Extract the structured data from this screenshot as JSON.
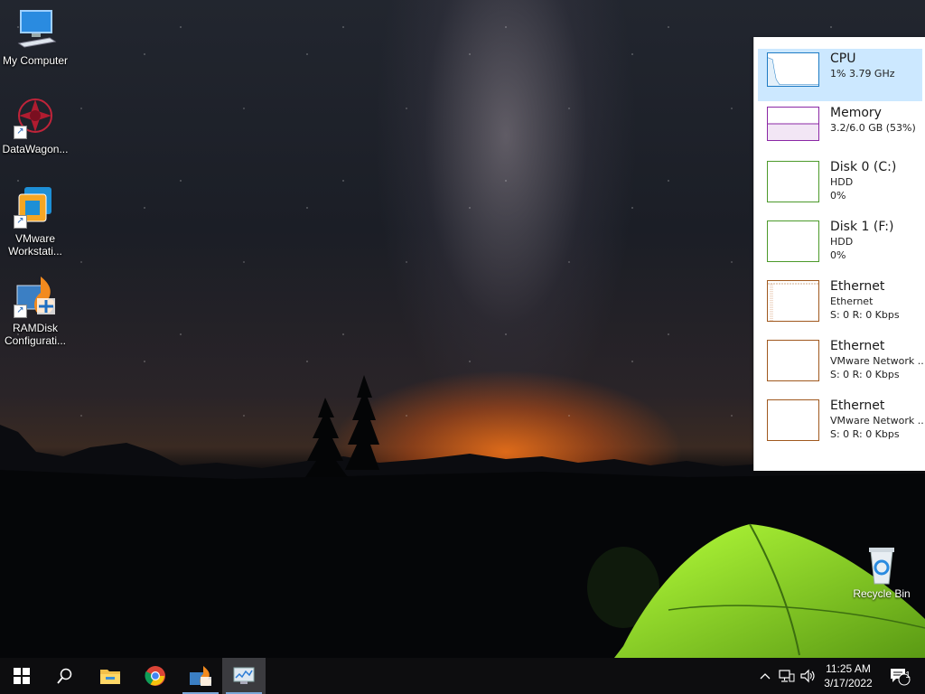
{
  "desktop": {
    "icons": [
      {
        "label": "My Computer",
        "icon": "computer-icon"
      },
      {
        "label": "DataWagon...",
        "icon": "datawagon-icon"
      },
      {
        "label": "VMware\nWorkstati...",
        "icon": "vmware-icon"
      },
      {
        "label": "RAMDisk\nConfigurati...",
        "icon": "ramdisk-icon"
      }
    ],
    "recycle_bin": {
      "label": "Recycle Bin",
      "icon": "recycle-bin-icon"
    }
  },
  "performance": {
    "items": [
      {
        "title": "CPU",
        "line1": "1% 3.79 GHz",
        "line2": "",
        "color": "#1e7bc4",
        "selected": true
      },
      {
        "title": "Memory",
        "line1": "3.2/6.0 GB (53%)",
        "line2": "",
        "color": "#8b27a5"
      },
      {
        "title": "Disk 0 (C:)",
        "line1": "HDD",
        "line2": "0%",
        "color": "#4c9a2a"
      },
      {
        "title": "Disk 1 (F:)",
        "line1": "HDD",
        "line2": "0%",
        "color": "#4c9a2a"
      },
      {
        "title": "Ethernet",
        "line1": "Ethernet",
        "line2": "S: 0 R: 0 Kbps",
        "color": "#a0581e"
      },
      {
        "title": "Ethernet",
        "line1": "VMware Network ...",
        "line2": "S: 0 R: 0 Kbps",
        "color": "#a0581e"
      },
      {
        "title": "Ethernet",
        "line1": "VMware Network ...",
        "line2": "S: 0 R: 0 Kbps",
        "color": "#a0581e"
      }
    ]
  },
  "taskbar": {
    "start_icon": "windows-start-icon",
    "search_icon": "search-icon",
    "apps": [
      {
        "name": "file-explorer-icon"
      },
      {
        "name": "chrome-icon"
      },
      {
        "name": "ramdisk-app-icon"
      },
      {
        "name": "task-manager-icon"
      }
    ],
    "tray": {
      "chevron": "chevron-up-icon",
      "network": "network-icon",
      "volume": "volume-icon",
      "time": "11:25 AM",
      "date": "3/17/2022",
      "notification_count": "1"
    }
  },
  "colors": {
    "selected_bg": "#cce8ff",
    "taskbar_bg": "#0d0d0f",
    "accent": "#7aa7d8"
  }
}
